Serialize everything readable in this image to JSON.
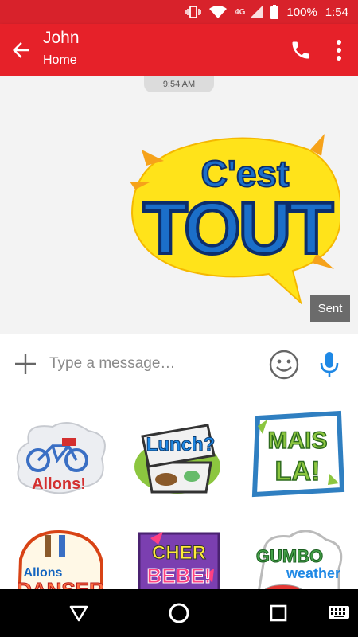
{
  "status_bar": {
    "network": "4G",
    "battery": "100%",
    "time": "1:54",
    "icons": [
      "vibrate-icon",
      "wifi-icon",
      "signal-icon",
      "battery-icon"
    ]
  },
  "header": {
    "title": "John",
    "subtitle": "Home",
    "icons": [
      "back-arrow-icon",
      "phone-icon",
      "more-vert-icon"
    ],
    "color": "#e62129"
  },
  "conversation": {
    "timestamp": "9:54 AM",
    "message": {
      "type": "sticker",
      "text_line1": "C'est",
      "text_line2": "TOUT",
      "status": "Sent"
    }
  },
  "compose": {
    "placeholder": "Type a message…",
    "icons": [
      "plus-icon",
      "emoji-icon",
      "microphone-icon"
    ],
    "mic_color": "#1e88e5"
  },
  "sticker_tray": [
    {
      "id": "allons",
      "text": "Allons!"
    },
    {
      "id": "lunch",
      "text": "Lunch?"
    },
    {
      "id": "mais-la",
      "text_line1": "MAIS",
      "text_line2": "LA!"
    },
    {
      "id": "allons-danser",
      "text_line1": "Allons",
      "text_line2": "DANSER"
    },
    {
      "id": "cher-bebe",
      "text_line1": "CHER",
      "text_line2": "BEBE!"
    },
    {
      "id": "gumbo-weather",
      "text_line1": "GUMBO",
      "text_line2": "weather"
    }
  ],
  "nav_bar": {
    "icons": [
      "back-triangle-icon",
      "home-circle-icon",
      "recents-square-icon",
      "keyboard-icon"
    ]
  }
}
